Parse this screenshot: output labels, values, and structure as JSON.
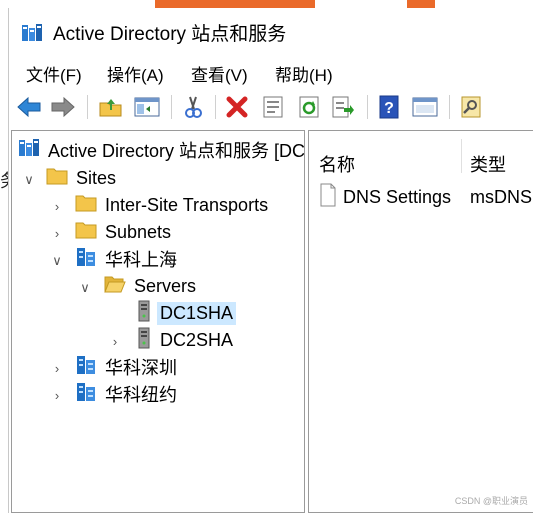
{
  "window": {
    "title": "Active Directory 站点和服务"
  },
  "menubar": {
    "items": [
      "文件(F)",
      "操作(A)",
      "查看(V)",
      "帮助(H)"
    ]
  },
  "toolbar": {
    "buttons": [
      "back-arrow-icon",
      "forward-arrow-icon",
      "up-folder-icon",
      "show-hide-tree-icon",
      "cut-icon",
      "delete-icon",
      "properties-icon",
      "refresh-icon",
      "export-list-icon",
      "help-icon",
      "console-view-icon",
      "find-icon"
    ]
  },
  "tree": {
    "root": "Active Directory 站点和服务 [DC",
    "sites": "Sites",
    "inter_site": "Inter-Site Transports",
    "subnets": "Subnets",
    "site_shanghai": "华科上海",
    "servers": "Servers",
    "dc1": "DC1SHA",
    "dc2": "DC2SHA",
    "site_shenzhen": "华科深圳",
    "site_newyork": "华科纽约"
  },
  "list": {
    "columns": [
      "名称",
      "类型"
    ],
    "rows": [
      {
        "name": "DNS Settings",
        "type": "msDNS"
      }
    ]
  },
  "left_edge_char": "务",
  "watermark": "CSDN @职业演员",
  "colors": {
    "selection": "#cce8ff",
    "folder": "#f3c54a",
    "site_blue": "#1e6fc4"
  }
}
